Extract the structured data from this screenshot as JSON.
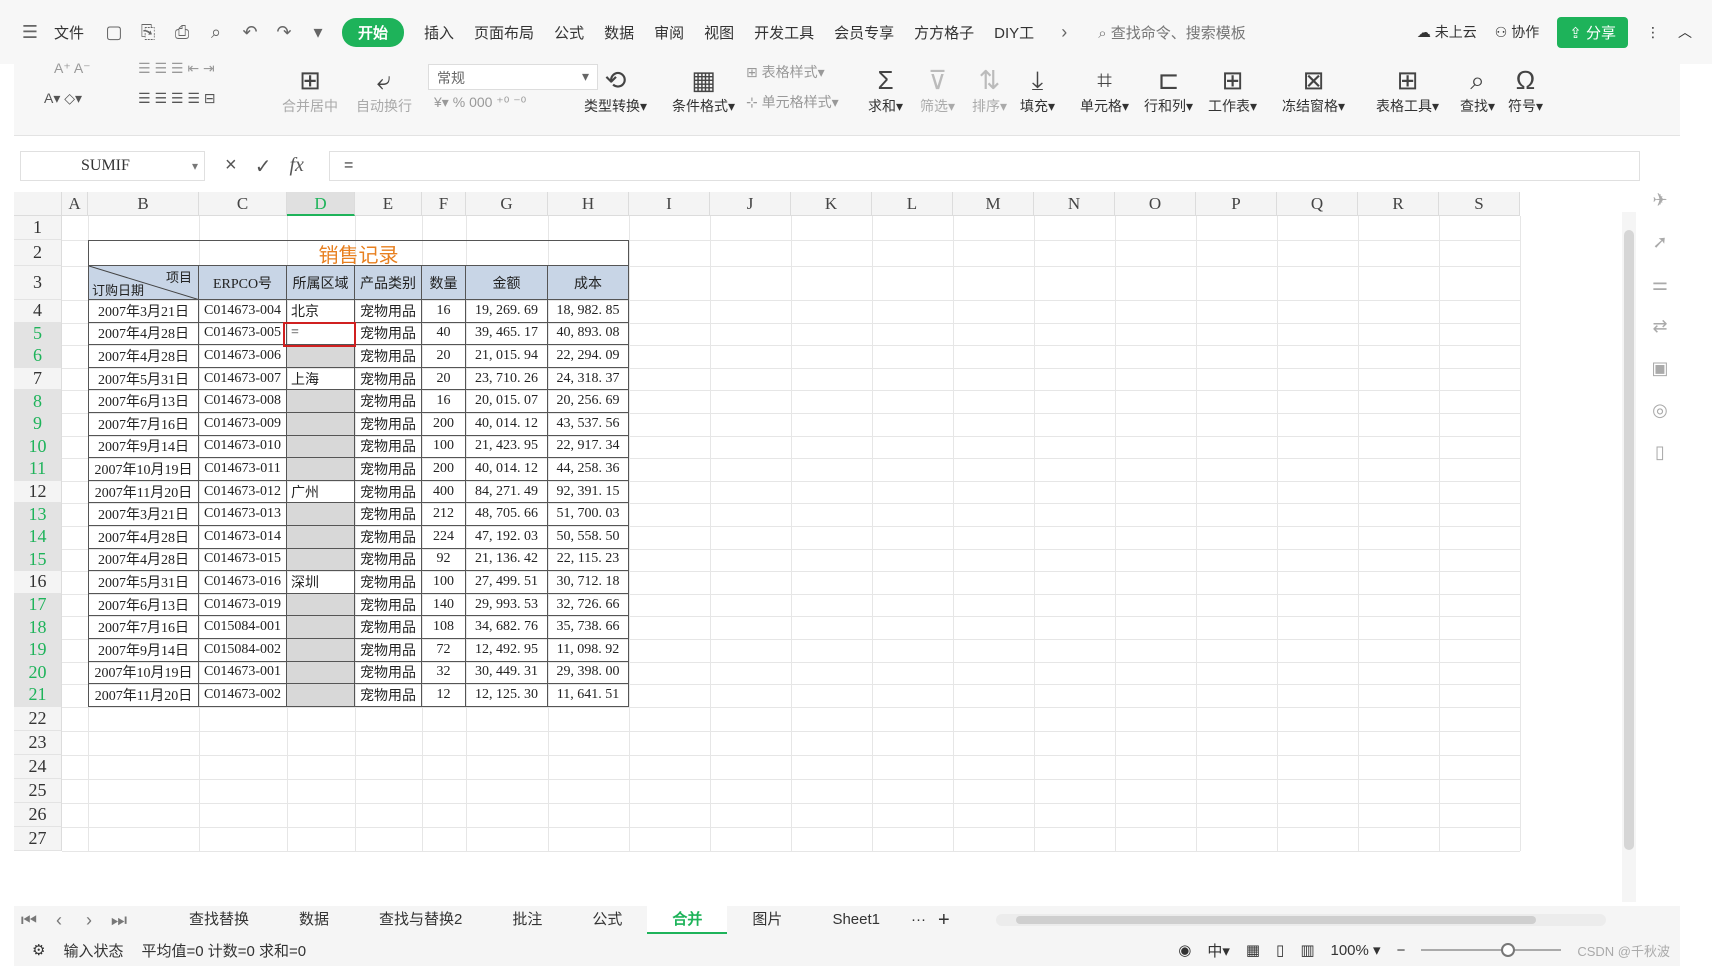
{
  "menubar": {
    "file_label": "文件",
    "tabs": [
      "开始",
      "插入",
      "页面布局",
      "公式",
      "数据",
      "审阅",
      "视图",
      "开发工具",
      "会员专享",
      "方方格子",
      "DIY工"
    ],
    "search_label": "查找命令、搜索模板",
    "cloud_label": "未上云",
    "collab_label": "协作",
    "share_label": "分享"
  },
  "ribbon": {
    "merge_center": "合并居中",
    "auto_wrap": "自动换行",
    "number_format": "常规",
    "type_convert": "类型转换",
    "cond_format": "条件格式",
    "table_style": "表格样式",
    "cell_style": "单元格样式",
    "sum": "求和",
    "filter": "筛选",
    "sort": "排序",
    "fill": "填充",
    "cell": "单元格",
    "row_col": "行和列",
    "worksheet": "工作表",
    "freeze": "冻结窗格",
    "table_tools": "表格工具",
    "find": "查找",
    "symbol": "符号",
    "currency_symbol": "¥",
    "percent_symbol": "%",
    "thousands_symbol": "000"
  },
  "formula": {
    "name_box": "SUMIF",
    "value": "="
  },
  "sheet": {
    "columns": [
      "A",
      "B",
      "C",
      "D",
      "E",
      "F",
      "G",
      "H",
      "I",
      "J",
      "K",
      "L",
      "M",
      "N",
      "O",
      "P",
      "Q",
      "R",
      "S"
    ],
    "rows": [
      "1",
      "2",
      "3",
      "4",
      "5",
      "6",
      "7",
      "8",
      "9",
      "10",
      "11",
      "12",
      "13",
      "14",
      "15",
      "16",
      "17",
      "18",
      "19",
      "20",
      "21",
      "22",
      "23",
      "24",
      "25",
      "26",
      "27"
    ],
    "active_column": "D",
    "selected_rows": [
      "5",
      "6",
      "8",
      "9",
      "10",
      "11",
      "13",
      "14",
      "15",
      "17",
      "18",
      "19",
      "20",
      "21"
    ]
  },
  "table": {
    "title": "销售记录",
    "diag_top": "项目",
    "diag_bottom": "订购日期",
    "headers": [
      "ERPCO号",
      "所属区域",
      "产品类别",
      "数量",
      "金额",
      "成本"
    ],
    "editing_value": "=",
    "rows": [
      {
        "date": "2007年3月21日",
        "erp": "C014673-004",
        "region": "北京",
        "grey": false,
        "cat": "宠物用品",
        "qty": "16",
        "amount": "19, 269. 69",
        "cost": "18, 982. 85"
      },
      {
        "date": "2007年4月28日",
        "erp": "C014673-005",
        "region": "",
        "grey": false,
        "cat": "宠物用品",
        "qty": "40",
        "amount": "39, 465. 17",
        "cost": "40, 893. 08"
      },
      {
        "date": "2007年4月28日",
        "erp": "C014673-006",
        "region": "",
        "grey": true,
        "cat": "宠物用品",
        "qty": "20",
        "amount": "21, 015. 94",
        "cost": "22, 294. 09"
      },
      {
        "date": "2007年5月31日",
        "erp": "C014673-007",
        "region": "上海",
        "grey": false,
        "cat": "宠物用品",
        "qty": "20",
        "amount": "23, 710. 26",
        "cost": "24, 318. 37"
      },
      {
        "date": "2007年6月13日",
        "erp": "C014673-008",
        "region": "",
        "grey": true,
        "cat": "宠物用品",
        "qty": "16",
        "amount": "20, 015. 07",
        "cost": "20, 256. 69"
      },
      {
        "date": "2007年7月16日",
        "erp": "C014673-009",
        "region": "",
        "grey": true,
        "cat": "宠物用品",
        "qty": "200",
        "amount": "40, 014. 12",
        "cost": "43, 537. 56"
      },
      {
        "date": "2007年9月14日",
        "erp": "C014673-010",
        "region": "",
        "grey": true,
        "cat": "宠物用品",
        "qty": "100",
        "amount": "21, 423. 95",
        "cost": "22, 917. 34"
      },
      {
        "date": "2007年10月19日",
        "erp": "C014673-011",
        "region": "",
        "grey": true,
        "cat": "宠物用品",
        "qty": "200",
        "amount": "40, 014. 12",
        "cost": "44, 258. 36"
      },
      {
        "date": "2007年11月20日",
        "erp": "C014673-012",
        "region": "广州",
        "grey": false,
        "cat": "宠物用品",
        "qty": "400",
        "amount": "84, 271. 49",
        "cost": "92, 391. 15"
      },
      {
        "date": "2007年3月21日",
        "erp": "C014673-013",
        "region": "",
        "grey": true,
        "cat": "宠物用品",
        "qty": "212",
        "amount": "48, 705. 66",
        "cost": "51, 700. 03"
      },
      {
        "date": "2007年4月28日",
        "erp": "C014673-014",
        "region": "",
        "grey": true,
        "cat": "宠物用品",
        "qty": "224",
        "amount": "47, 192. 03",
        "cost": "50, 558. 50"
      },
      {
        "date": "2007年4月28日",
        "erp": "C014673-015",
        "region": "",
        "grey": true,
        "cat": "宠物用品",
        "qty": "92",
        "amount": "21, 136. 42",
        "cost": "22, 115. 23"
      },
      {
        "date": "2007年5月31日",
        "erp": "C014673-016",
        "region": "深圳",
        "grey": false,
        "cat": "宠物用品",
        "qty": "100",
        "amount": "27, 499. 51",
        "cost": "30, 712. 18"
      },
      {
        "date": "2007年6月13日",
        "erp": "C014673-019",
        "region": "",
        "grey": true,
        "cat": "宠物用品",
        "qty": "140",
        "amount": "29, 993. 53",
        "cost": "32, 726. 66"
      },
      {
        "date": "2007年7月16日",
        "erp": "C015084-001",
        "region": "",
        "grey": true,
        "cat": "宠物用品",
        "qty": "108",
        "amount": "34, 682. 76",
        "cost": "35, 738. 66"
      },
      {
        "date": "2007年9月14日",
        "erp": "C015084-002",
        "region": "",
        "grey": true,
        "cat": "宠物用品",
        "qty": "72",
        "amount": "12, 492. 95",
        "cost": "11, 098. 92"
      },
      {
        "date": "2007年10月19日",
        "erp": "C014673-001",
        "region": "",
        "grey": true,
        "cat": "宠物用品",
        "qty": "32",
        "amount": "30, 449. 31",
        "cost": "29, 398. 00"
      },
      {
        "date": "2007年11月20日",
        "erp": "C014673-002",
        "region": "",
        "grey": true,
        "cat": "宠物用品",
        "qty": "12",
        "amount": "12, 125. 30",
        "cost": "11, 641. 51"
      }
    ]
  },
  "tabs": {
    "sheets": [
      "查找替换",
      "数据",
      "查找与替换2",
      "批注",
      "公式",
      "合并",
      "图片",
      "Sheet1"
    ],
    "active": "合并",
    "more": "···",
    "add": "+"
  },
  "status": {
    "input_state": "输入状态",
    "stats": "平均值=0  计数=0  求和=0",
    "zoom": "100%",
    "watermark": "CSDN @千秋波"
  },
  "colors": {
    "accent": "#1eb35a",
    "title": "#e88020",
    "selection": "#d02020"
  }
}
